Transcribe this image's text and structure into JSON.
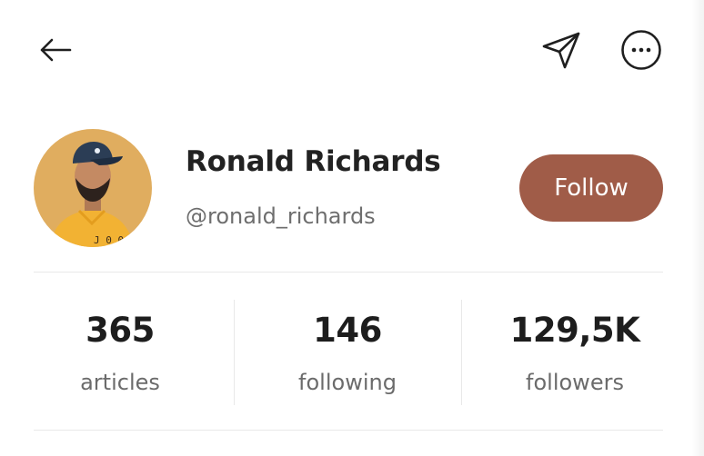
{
  "header": {
    "back_icon": "arrow-left-icon",
    "share_icon": "send-icon",
    "more_icon": "more-horizontal-circle-icon"
  },
  "profile": {
    "name": "Ronald Richards",
    "handle": "@ronald_richards",
    "avatar_bg": "#e0ad5f",
    "follow_label": "Follow",
    "follow_color": "#a05c48"
  },
  "stats": [
    {
      "value": "365",
      "label": "articles"
    },
    {
      "value": "146",
      "label": "following"
    },
    {
      "value": "129,5K",
      "label": "followers"
    }
  ]
}
